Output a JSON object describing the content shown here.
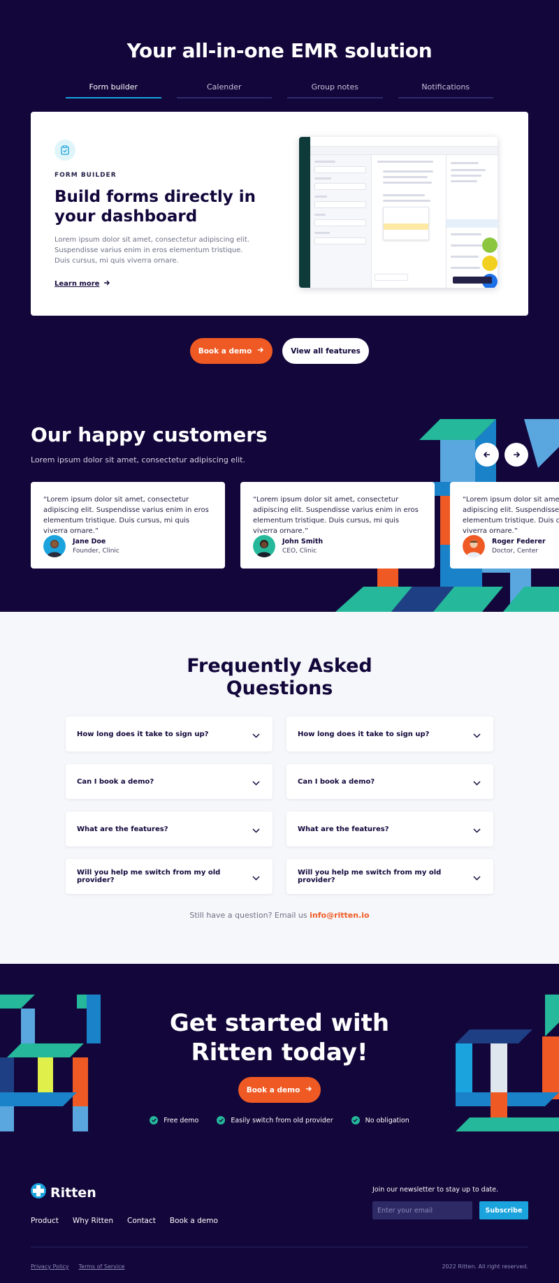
{
  "hero": {
    "title": "Your all-in-one EMR solution",
    "tabs": [
      {
        "label": "Form builder"
      },
      {
        "label": "Calender"
      },
      {
        "label": "Group notes"
      },
      {
        "label": "Notifications"
      }
    ],
    "card": {
      "eyebrow": "FORM BUILDER",
      "heading": "Build forms directly in your dashboard",
      "body": "Lorem ipsum dolor sit amet, consectetur adipiscing elit. Suspendisse varius enim in eros elementum tristique. Duis cursus, mi quis viverra ornare.",
      "link": "Learn more"
    },
    "buttons": {
      "demo": "Book a demo",
      "features": "View all features"
    }
  },
  "customers": {
    "title": "Our happy customers",
    "subtitle": "Lorem ipsum dolor sit amet, consectetur adipiscing elit.",
    "testimonials": [
      {
        "quote": "“Lorem ipsum dolor sit amet, consectetur adipiscing elit. Suspendisse varius enim in eros elementum tristique. Duis cursus, mi quis viverra ornare.”",
        "name": "Jane Doe",
        "role": "Founder, Clinic"
      },
      {
        "quote": "“Lorem ipsum dolor sit amet, consectetur adipiscing elit. Suspendisse varius enim in eros elementum tristique. Duis cursus, mi quis viverra ornare.”",
        "name": "John Smith",
        "role": "CEO, Clinic"
      },
      {
        "quote": "“Lorem ipsum dolor sit amet, consectetur adipiscing elit. Suspendisse varius enim in eros elementum tristique. Duis cursus, mi quis viverra ornare.”",
        "name": "Roger Federer",
        "role": "Doctor, Center"
      }
    ]
  },
  "faq": {
    "title_line1": "Frequently Asked",
    "title_line2": "Questions",
    "items": [
      {
        "q": "How long does it take to sign up?"
      },
      {
        "q": "How long does it take to sign up?"
      },
      {
        "q": "Can I book a demo?"
      },
      {
        "q": "Can I book a demo?"
      },
      {
        "q": "What are the features?"
      },
      {
        "q": "What are the features?"
      },
      {
        "q": "Will you help me switch from my old provider?"
      },
      {
        "q": "Will you help me switch from my old provider?"
      }
    ],
    "footer_text": "Still have a question? Email us ",
    "footer_email": "info@ritten.io"
  },
  "cta": {
    "title_line1": "Get started with",
    "title_line2": "Ritten today!",
    "button": "Book a demo",
    "checks": [
      "Free demo",
      "Easily switch from old provider",
      "No obligation"
    ]
  },
  "footer": {
    "brand": "Ritten",
    "links": [
      "Product",
      "Why Ritten",
      "Contact",
      "Book a demo"
    ],
    "newsletter_label": "Join our newsletter to stay up to date.",
    "email_placeholder": "Enter your email",
    "subscribe": "Subscribe",
    "legal": [
      "Privacy Policy",
      "Terms of Service"
    ],
    "copyright": "2022 Ritten. All right reserved."
  },
  "colors": {
    "navy": "#12063a",
    "orange": "#ef5a24",
    "blue": "#1aa3dd",
    "teal": "#25b89b",
    "background_light": "#f6f7fa"
  }
}
